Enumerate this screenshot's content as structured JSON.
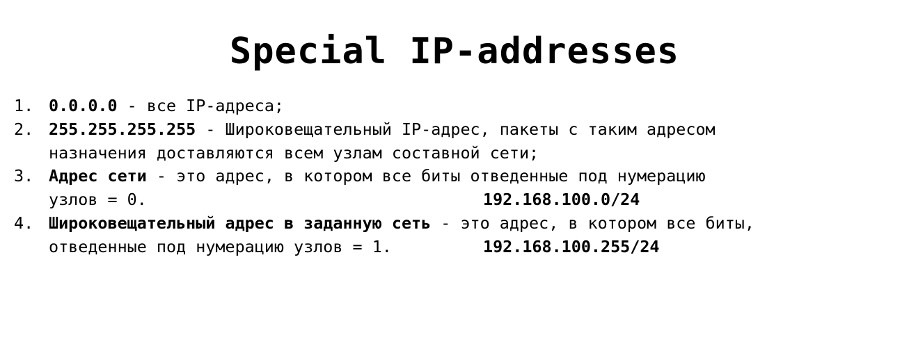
{
  "title": "Special IP-addresses",
  "items": [
    {
      "number": "1.",
      "bold": "0.0.0.0",
      "text": " - все IP-адреса;"
    },
    {
      "number": "2.",
      "bold": "255.255.255.255",
      "text": " - Широковещательный IP-адрес, пакеты с таким адресом",
      "text2": "назначения доставляются всем узлам составной сети;"
    },
    {
      "number": "3.",
      "bold": "Адрес сети",
      "text": " - это адрес, в котором все биты отведенные под нумерацию",
      "text2": "узлов = 0.",
      "example": "192.168.100.0/24"
    },
    {
      "number": "4.",
      "bold": "Широковещательный адрес в заданную сеть",
      "text": " - это адрес, в котором все биты,",
      "text2": "отведенные под нумерацию узлов = 1.",
      "example": "192.168.100.255/24"
    }
  ]
}
